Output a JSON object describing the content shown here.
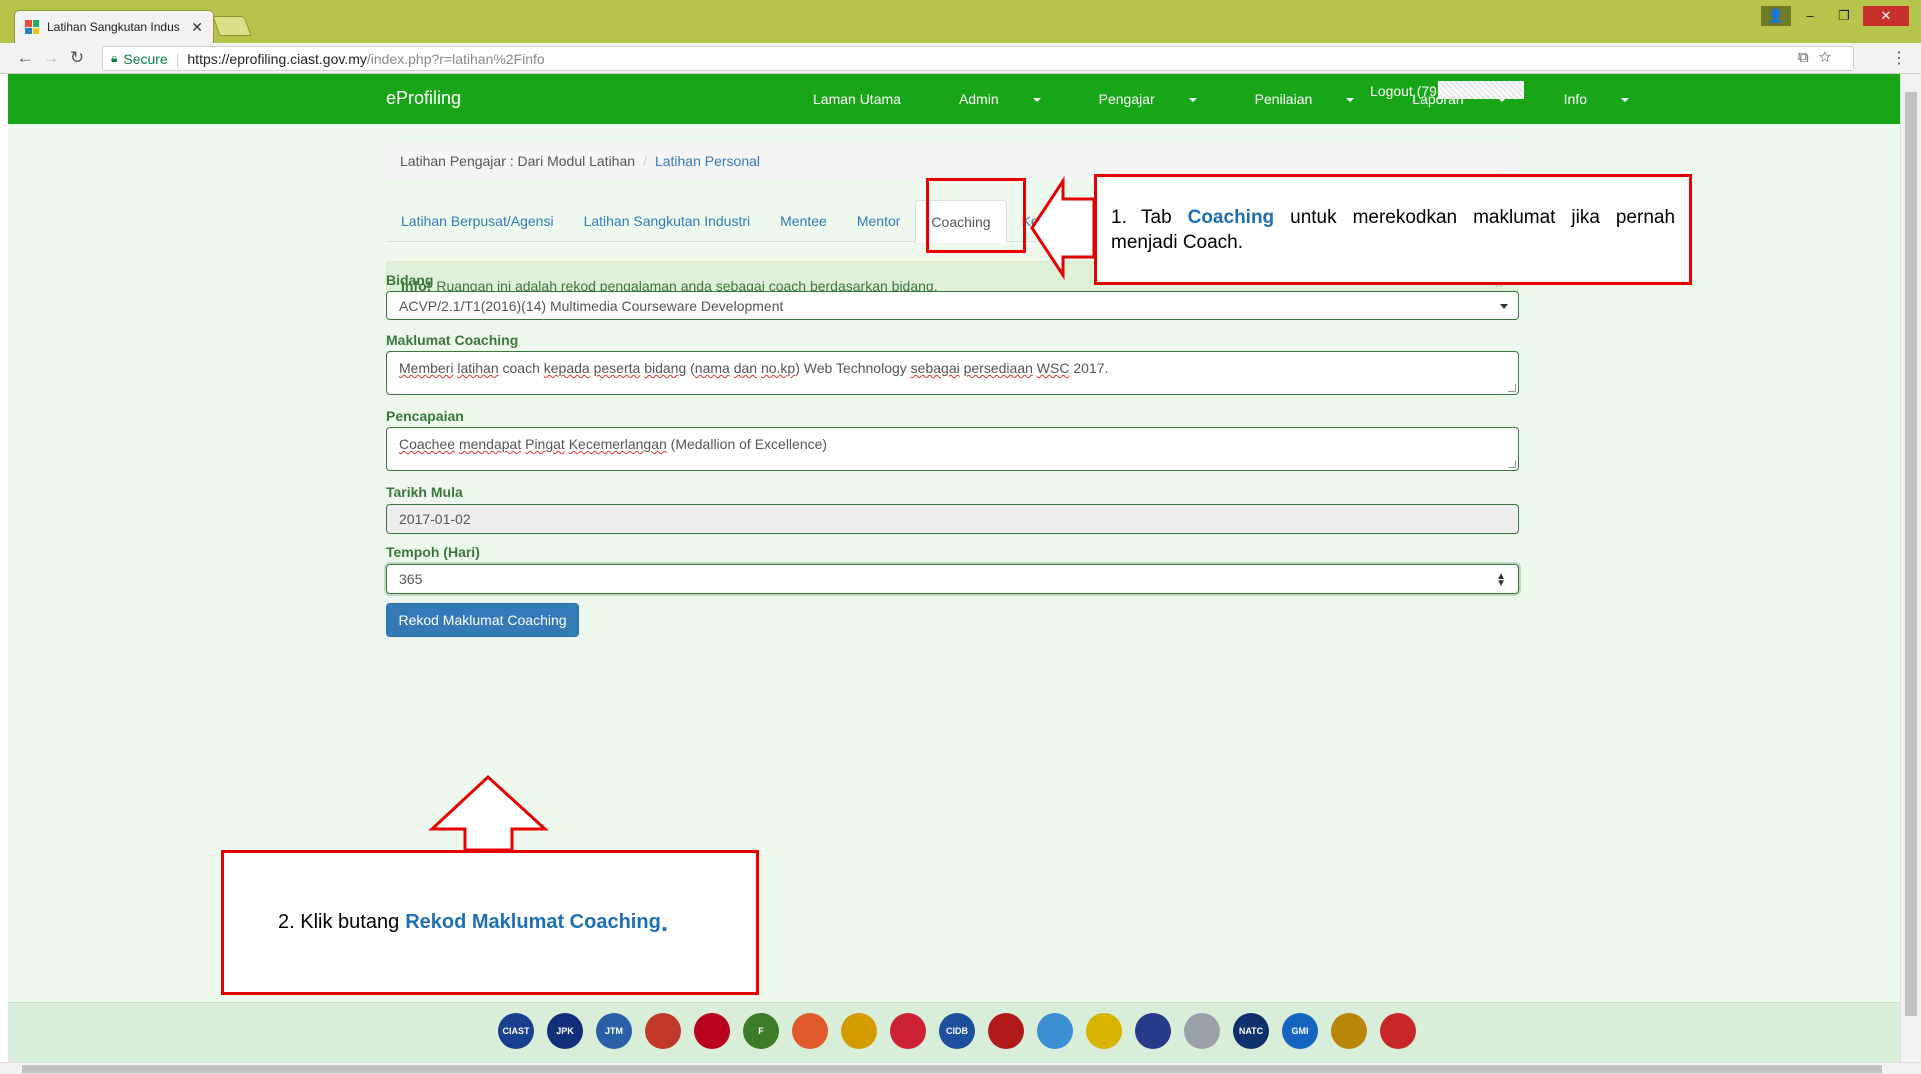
{
  "browser": {
    "tab_title": "Latihan Sangkutan Indus",
    "tab_close": "✕",
    "secure_label": "Secure",
    "url_host": "https://eprofiling.ciast.gov.my",
    "url_path": "/index.php?r=latihan%2Finfo",
    "icons": [
      "back-icon",
      "forward-icon",
      "reload-icon",
      "lock-icon",
      "translate-icon",
      "star-icon",
      "menu-icon"
    ]
  },
  "nav": {
    "brand": "eProfiling",
    "items": [
      {
        "label": "Laman Utama",
        "dropdown": false
      },
      {
        "label": "Admin",
        "dropdown": true
      },
      {
        "label": "Pengajar",
        "dropdown": true
      },
      {
        "label": "Penilaian",
        "dropdown": true
      },
      {
        "label": "Laporan",
        "dropdown": true
      },
      {
        "label": "Info",
        "dropdown": true
      }
    ],
    "logout": "Logout (79",
    "color": "#18a518"
  },
  "breadcrumb": {
    "part1": "Latihan Pengajar : Dari Modul Latihan",
    "separator": "/",
    "part2": "Latihan Personal"
  },
  "tabs": [
    {
      "label": "Latihan Berpusat/Agensi",
      "active": false
    },
    {
      "label": "Latihan Sangkutan Industri",
      "active": false
    },
    {
      "label": "Mentee",
      "active": false
    },
    {
      "label": "Mentor",
      "active": false
    },
    {
      "label": "Coaching",
      "active": true
    },
    {
      "label": "Ken",
      "active": false
    }
  ],
  "alert": {
    "strong": "Info!",
    "text": "Ruangan ini adalah rekod pengalaman anda sebagai coach berdasarkan bidang.",
    "close": "×"
  },
  "form": {
    "bidang_label": "Bidang",
    "bidang_value": "ACVP/2.1/T1(2016)(14) Multimedia Courseware Development",
    "maklumat_label": "Maklumat Coaching",
    "maklumat_parts": [
      "Memberi",
      " ",
      "latihan",
      " coach ",
      "kepada",
      " ",
      "peserta",
      " ",
      "bidang",
      " (",
      "nama",
      " ",
      "dan",
      " ",
      "no.kp",
      ") Web Technology ",
      "sebagai",
      " ",
      "persediaan",
      " ",
      "WSC",
      " 2017."
    ],
    "pencapaian_label": "Pencapaian",
    "pencapaian_parts": [
      "Coachee",
      " ",
      "mendapat",
      " ",
      "Pingat",
      " ",
      "Kecemerlangan",
      " (Medallion of Excellence)"
    ],
    "tarikh_label": "Tarikh Mula",
    "tarikh_value": "2017-01-02",
    "tempoh_label": "Tempoh (Hari)",
    "tempoh_value": "365",
    "submit_label": "Rekod Maklumat Coaching"
  },
  "annotations": {
    "ann1_num": "1.",
    "ann1_pre": "Tab",
    "ann1_hl": "Coaching",
    "ann1_post": "untuk merekodkan maklumat jika pernah menjadi Coach.",
    "ann2_pre": "2. Klik butang",
    "ann2_hl": "Rekod Maklumat Coaching",
    "ann2_dot": ".",
    "color": "#e60000"
  },
  "footer": {
    "logos": [
      {
        "name": "ciast-logo",
        "text": "CIAST",
        "color": "#1b3f8f"
      },
      {
        "name": "jpk-logo",
        "text": "JPK",
        "color": "#12307a"
      },
      {
        "name": "jtm-logo",
        "text": "JTM",
        "color": "#2b5fa8"
      },
      {
        "name": "seal-logo",
        "text": "",
        "color": "#c0392b"
      },
      {
        "name": "mara-logo",
        "text": "",
        "color": "#b8001f"
      },
      {
        "name": "f-logo",
        "text": "F",
        "color": "#3d7a2a"
      },
      {
        "name": "ship-logo",
        "text": "",
        "color": "#e05a2b"
      },
      {
        "name": "kkr-logo",
        "text": "",
        "color": "#d49b00"
      },
      {
        "name": "flag-logo",
        "text": "",
        "color": "#cc2233"
      },
      {
        "name": "cidb-logo",
        "text": "CIDB",
        "color": "#1e4f9c"
      },
      {
        "name": "red-circle-logo",
        "text": "",
        "color": "#b31b1b"
      },
      {
        "name": "colorful-logo",
        "text": "",
        "color": "#3c8fd3"
      },
      {
        "name": "star-logo",
        "text": "",
        "color": "#d8b400"
      },
      {
        "name": "crest-logo",
        "text": "",
        "color": "#2a3a8a"
      },
      {
        "name": "grey-crest-logo",
        "text": "",
        "color": "#9aa0a8"
      },
      {
        "name": "natc-logo",
        "text": "NATC",
        "color": "#10306b"
      },
      {
        "name": "gmi-logo",
        "text": "GMI",
        "color": "#1565c0"
      },
      {
        "name": "gold-badge-logo",
        "text": "",
        "color": "#b8860b"
      },
      {
        "name": "red-gear-logo",
        "text": "",
        "color": "#c62828"
      }
    ]
  }
}
